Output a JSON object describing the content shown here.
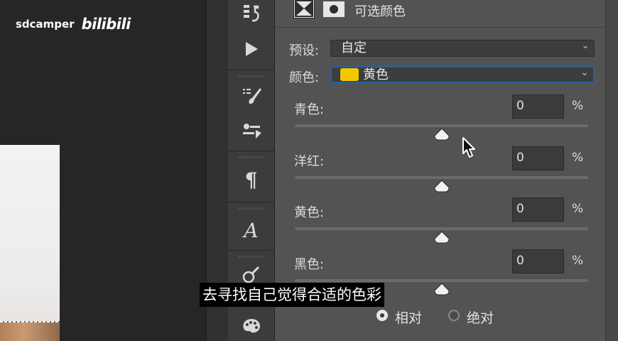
{
  "watermark": {
    "user": "sdcamper",
    "logo": "bilibili"
  },
  "panel": {
    "title": "可选颜色",
    "preset_label": "预设:",
    "preset_value": "自定",
    "color_label": "颜色:",
    "color_value": "黄色",
    "color_swatch": "#f2c800",
    "sliders": [
      {
        "label": "青色:",
        "value": "0",
        "unit": "%",
        "position": 0.5
      },
      {
        "label": "洋红:",
        "value": "0",
        "unit": "%",
        "position": 0.5
      },
      {
        "label": "黄色:",
        "value": "0",
        "unit": "%",
        "position": 0.5
      },
      {
        "label": "黑色:",
        "value": "0",
        "unit": "%",
        "position": 0.5
      }
    ],
    "method": {
      "options": [
        "相对",
        "绝对"
      ],
      "selected": "相对"
    }
  },
  "subtitle": "去寻找自己觉得合适的色彩",
  "tools": [
    "history-icon",
    "play-icon",
    "brush-settings-icon",
    "adjust-sliders-icon",
    "paragraph-icon",
    "character-style-icon",
    "clone-source-icon",
    "palette-icon"
  ]
}
